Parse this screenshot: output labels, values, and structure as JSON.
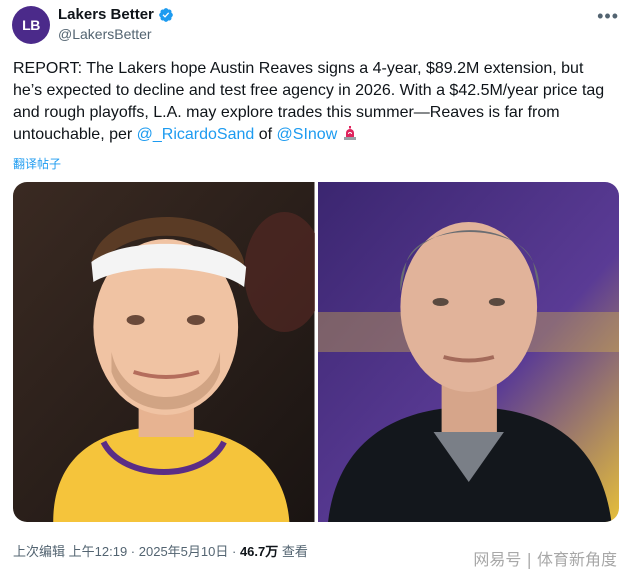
{
  "author": {
    "avatar_text": "LB",
    "display_name": "Lakers Better",
    "handle": "@LakersBetter",
    "verified_icon": "verified-badge-icon",
    "more_icon": "more-options-icon"
  },
  "tweet": {
    "text_before_links": "REPORT: The Lakers hope Austin Reaves signs a 4-year, $89.2M extension, but he’s expected to decline and test free agency in 2026. With a $42.5M/year price tag and rough playoffs, L.A. may explore trades this summer—Reaves is far from untouchable, per ",
    "mention_1": "@_RicardoSand",
    "joiner": " of ",
    "mention_2": "@SInow",
    "trailing_icon": "siren-icon",
    "translate_label": "翻译帖子"
  },
  "media": {
    "photos": [
      "player-headband-photo",
      "executive-portrait-photo"
    ]
  },
  "meta": {
    "edited": "上次编辑",
    "time": "上午12:19",
    "sep1": " · ",
    "date": "2025年5月10日",
    "sep2": " · ",
    "views": "46.7万",
    "views_label": " 查看"
  },
  "watermark": "网易号 | 体育新角度",
  "colors": {
    "link": "#1d9bf0",
    "avatar_bg": "#4b2a8a",
    "secondary_text": "#536471"
  }
}
